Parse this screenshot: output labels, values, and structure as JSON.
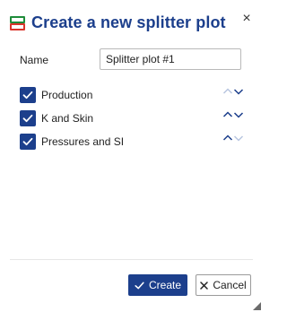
{
  "dialog": {
    "title": "Create a new splitter plot",
    "close_symbol": "×",
    "icon": "splitter-plot-icon"
  },
  "name_field": {
    "label": "Name",
    "value": "Splitter plot #1"
  },
  "options": [
    {
      "label": "Production",
      "checked": true,
      "up_enabled": false,
      "down_enabled": true
    },
    {
      "label": "K and Skin",
      "checked": true,
      "up_enabled": true,
      "down_enabled": true
    },
    {
      "label": "Pressures and SI",
      "checked": true,
      "up_enabled": true,
      "down_enabled": false
    }
  ],
  "buttons": {
    "create_label": "Create",
    "cancel_label": "Cancel"
  },
  "colors": {
    "accent": "#1c3f8c",
    "disabled_arrow": "#b8c6e0",
    "icon_green": "#1e8c3a",
    "icon_red": "#d9342b"
  }
}
